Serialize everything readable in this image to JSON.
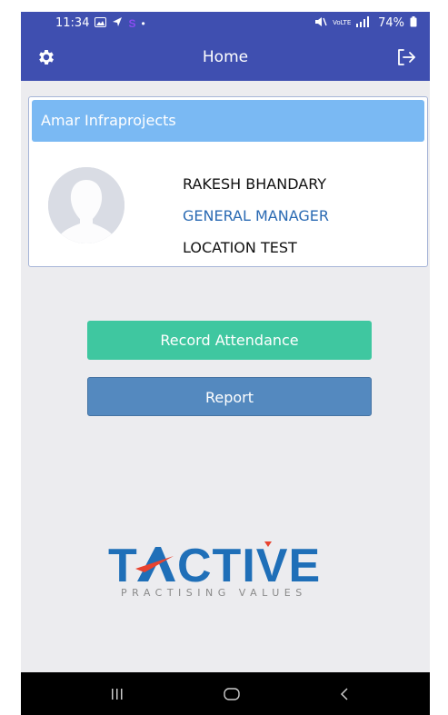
{
  "status_bar": {
    "time": "11:34",
    "battery": "74%",
    "signal_text": "VoLTE"
  },
  "app_bar": {
    "title": "Home",
    "settings_icon": "gear-icon",
    "logout_icon": "logout-icon"
  },
  "profile_card": {
    "company": "Amar Infraprojects",
    "name": "RAKESH BHANDARY",
    "designation": "GENERAL MANAGER",
    "location": "LOCATION TEST",
    "avatar_icon": "user-avatar-icon"
  },
  "actions": {
    "record_attendance": "Record Attendance",
    "report": "Report"
  },
  "logo": {
    "brand": "TACTIVE",
    "tagline": "PRACTISING VALUES"
  },
  "colors": {
    "appbar": "#3f4fb0",
    "card_header": "#7ab9f3",
    "attendance_button": "#3fc7a0",
    "report_button": "#5489bf",
    "logo_red": "#e8432f",
    "logo_blue": "#1f6fb8"
  }
}
